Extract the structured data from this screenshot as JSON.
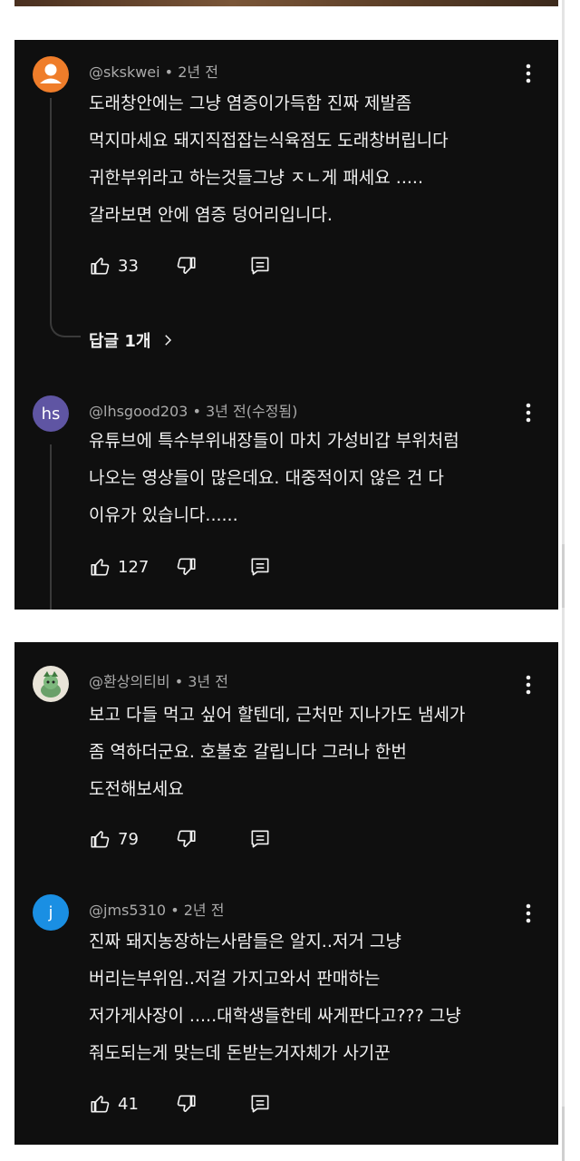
{
  "colors": {
    "panel_bg": "#0f0f0f",
    "text_primary": "#f1f1f1",
    "text_secondary": "#aaaaaa",
    "avatar_orange": "#ef7d2a",
    "avatar_purple": "#5f55a3",
    "avatar_blue": "#1a8fe3"
  },
  "comments": [
    {
      "avatar_type": "person-icon",
      "avatar_letter": "",
      "author": "@skskwei",
      "time": "2년 전",
      "edited": "",
      "lines": [
        "도래창안에는 그냥 염증이가득함 진짜 제발좀",
        "먹지마세요 돼지직접잡는식육점도 도래창버립니다",
        "귀한부위라고 하는것들그냥 ㅈㄴ게 패세요 .....",
        "갈라보면 안에 염증 덩어리입니다."
      ],
      "likes": "33",
      "replies_label": "답글 1개"
    },
    {
      "avatar_type": "letters",
      "avatar_letter": "hs",
      "author": "@lhsgood203",
      "time": "3년 전",
      "edited": "(수정됨)",
      "lines": [
        "유튜브에 특수부위내장들이 마치 가성비갑 부위처럼",
        "나오는 영상들이 많은데요.  대중적이지 않은 건 다",
        "이유가 있습니다......"
      ],
      "likes": "127"
    },
    {
      "avatar_type": "creature-icon",
      "avatar_letter": "",
      "author": "@환상의티비",
      "time": "3년 전",
      "edited": "",
      "lines": [
        "보고 다들 먹고 싶어 할텐데,  근처만 지나가도 냄세가",
        "좀 역하더군요. 호불호 갈립니다 그러나 한번",
        "도전해보세요"
      ],
      "likes": "79"
    },
    {
      "avatar_type": "letters",
      "avatar_letter": "j",
      "author": "@jms5310",
      "time": "2년 전",
      "edited": "",
      "lines": [
        "진짜 돼지농장하는사람들은 알지..저거 그냥",
        "버리는부위임..저걸 가지고와서 판매하는",
        "저가게사장이 .....대학생들한테 싸게판다고???  그냥",
        "줘도되는게 맞는데 돈받는거자체가 사기꾼"
      ],
      "likes": "41"
    }
  ]
}
